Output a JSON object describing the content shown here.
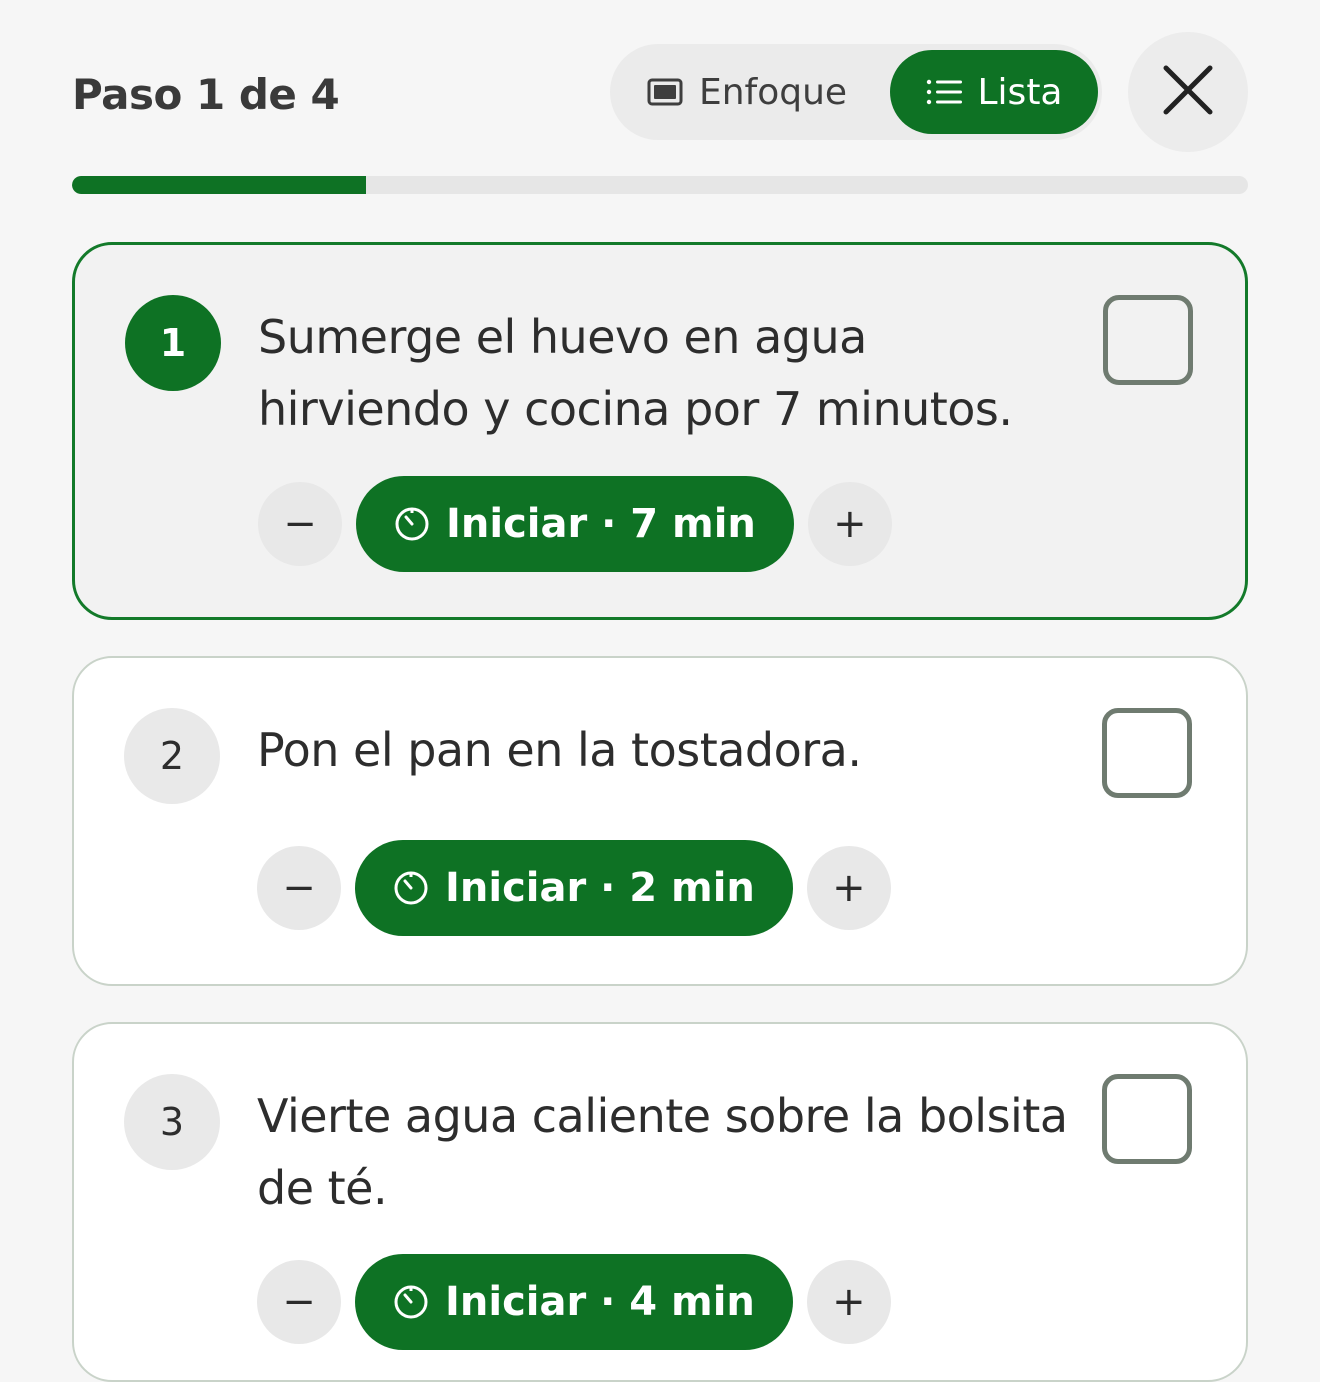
{
  "header": {
    "step_indicator": "Paso 1 de 4",
    "modes": {
      "focus_label": "Enfoque",
      "list_label": "Lista",
      "selected": "Lista"
    },
    "close_icon": "close-icon"
  },
  "progress": {
    "current_step": 1,
    "total_steps": 4,
    "fraction": 0.25
  },
  "colors": {
    "accent": "#0e7224",
    "active_border": "#137a2a",
    "background": "#f6f6f6"
  },
  "steps": [
    {
      "number": "1",
      "text": "Sumerge el huevo en agua hirviendo y cocina por 7 minutos.",
      "timer_label": "Iniciar · 7 min",
      "decrement": "−",
      "increment": "+",
      "active": true,
      "checked": false
    },
    {
      "number": "2",
      "text": "Pon el pan en la tostadora.",
      "timer_label": "Iniciar · 2 min",
      "decrement": "−",
      "increment": "+",
      "active": false,
      "checked": false
    },
    {
      "number": "3",
      "text": "Vierte agua caliente sobre la bolsita de té.",
      "timer_label": "Iniciar · 4 min",
      "decrement": "−",
      "increment": "+",
      "active": false,
      "checked": false
    }
  ]
}
